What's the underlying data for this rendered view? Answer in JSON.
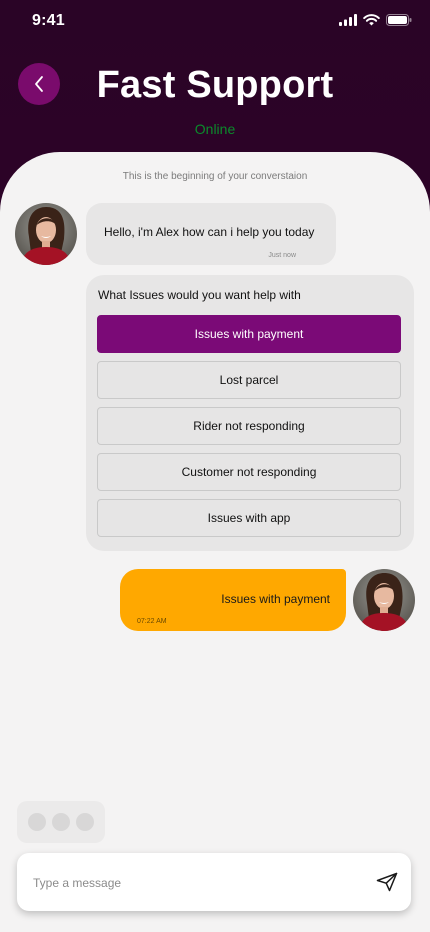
{
  "status_bar": {
    "time": "9:41",
    "icons": [
      "signal-icon",
      "wifi-icon",
      "battery-icon"
    ]
  },
  "header": {
    "title": "Fast Support",
    "status": "Online",
    "back_icon": "chevron-left-icon"
  },
  "chat": {
    "beginning_text": "This is the beginning of your converstaion",
    "agent_message": {
      "text": "Hello, i'm Alex how can i help you today",
      "time": "Just now"
    },
    "options_prompt": "What Issues would you want help with",
    "options": [
      {
        "label": "Issues with payment",
        "selected": true
      },
      {
        "label": "Lost parcel",
        "selected": false
      },
      {
        "label": "Rider not responding",
        "selected": false
      },
      {
        "label": "Customer not responding",
        "selected": false
      },
      {
        "label": "Issues with app",
        "selected": false
      }
    ],
    "user_message": {
      "text": "Issues with payment",
      "time": "07:22 AM"
    }
  },
  "composer": {
    "placeholder": "Type a message",
    "send_icon": "send-icon"
  },
  "colors": {
    "header_bg": "#31002a",
    "accent": "#7b0a77",
    "user_bubble": "#ffa800",
    "online": "#0b8b2b",
    "chat_bg": "#f4f3f3"
  }
}
